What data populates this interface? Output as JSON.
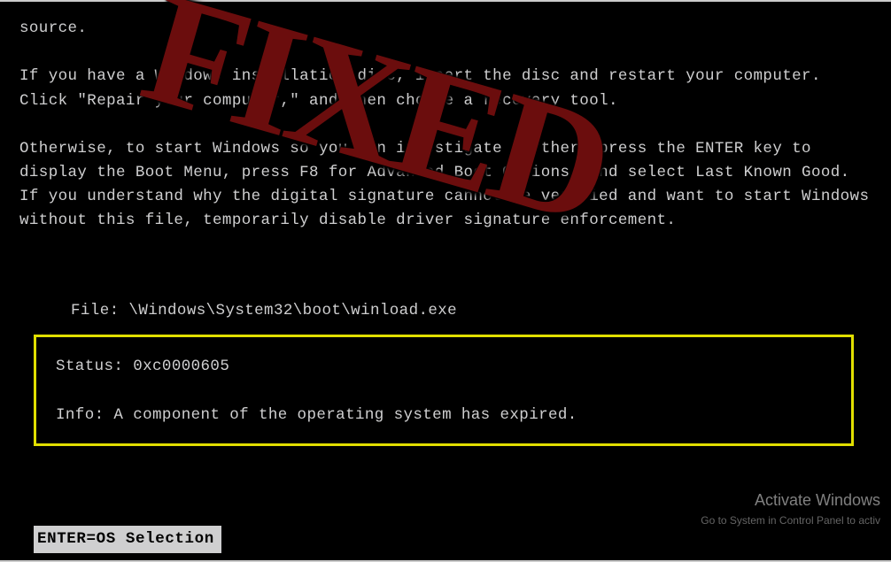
{
  "para0": "source.",
  "para1": "If you have a Windows installation disc, insert the disc and restart your computer. Click \"Repair your computer,\" and then choose a recovery tool.",
  "para2": "Otherwise, to start Windows so you can investigate further, press the ENTER key to display the Boot Menu, press F8 for Advanced Boot Options, and select Last Known Good. If you understand why the digital signature cannot be verified and want to start Windows without this file, temporarily disable driver signature enforcement.",
  "file": {
    "label": "File:",
    "value": "\\Windows\\System32\\boot\\winload.exe"
  },
  "status": {
    "label": "Status:",
    "value": "0xc0000605"
  },
  "info": {
    "label": "Info:",
    "value": "A component of the operating system has expired."
  },
  "footer": "ENTER=OS Selection",
  "activate": {
    "title": "Activate Windows",
    "subtitle": "Go to System in Control Panel to activ"
  },
  "stamp": "FIXED"
}
